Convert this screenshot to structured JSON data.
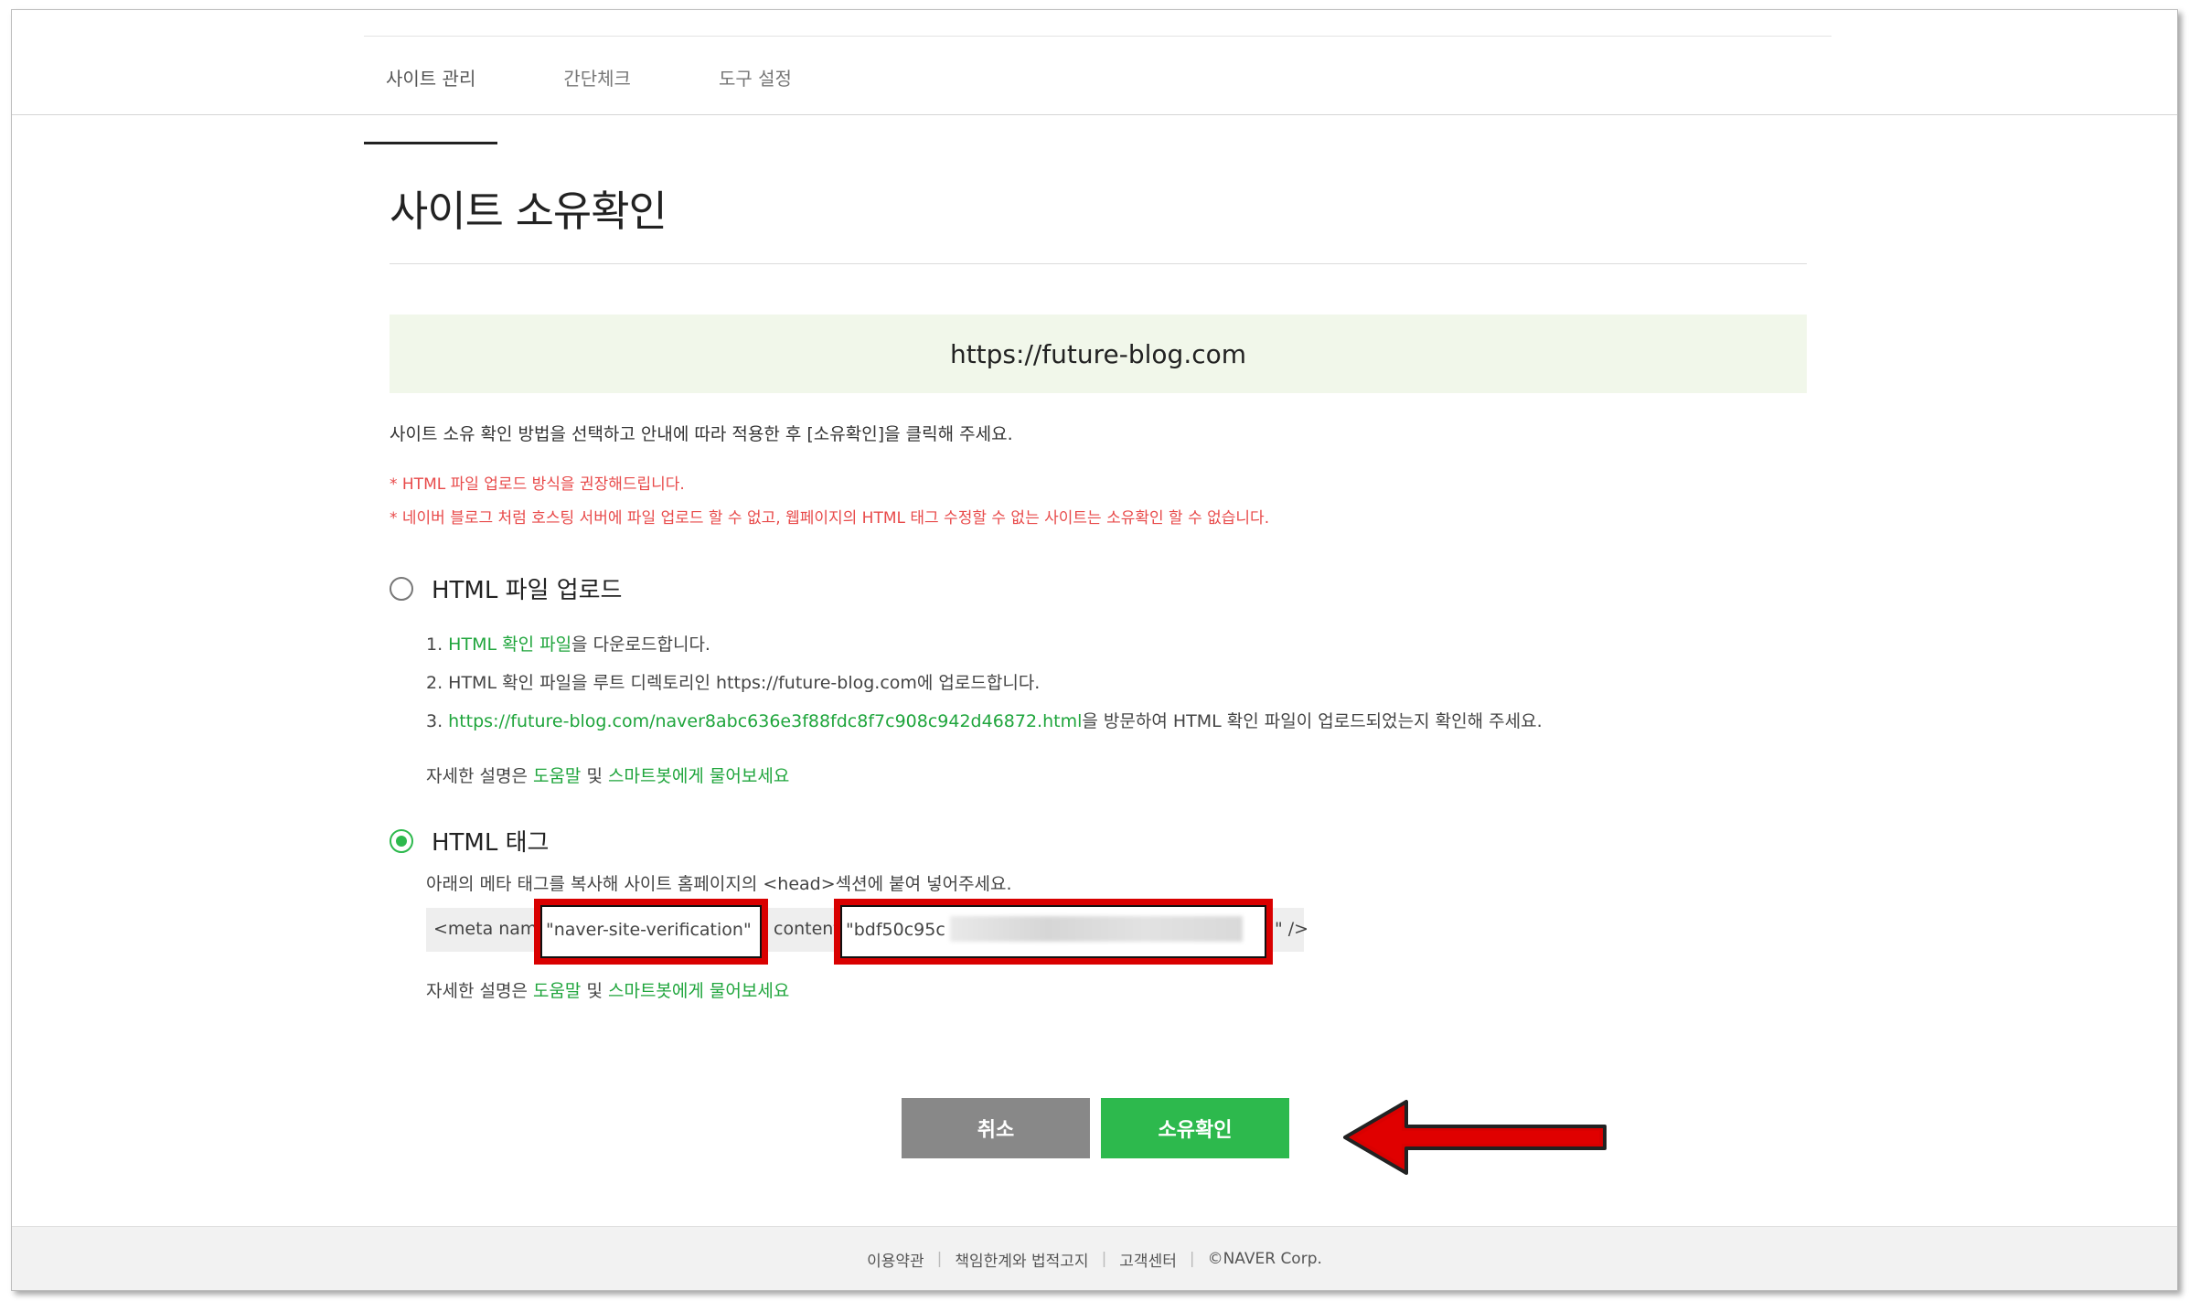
{
  "nav": {
    "tabs": [
      {
        "label": "사이트 관리",
        "active": true
      },
      {
        "label": "간단체크",
        "active": false
      },
      {
        "label": "도구 설정",
        "active": false
      }
    ]
  },
  "page": {
    "title": "사이트 소유확인",
    "site_url": "https://future-blog.com",
    "intro": "사이트 소유 확인 방법을 선택하고 안내에 따라 적용한 후 [소유확인]을 클릭해 주세요.",
    "warnings": [
      "* HTML 파일 업로드 방식을 권장해드립니다.",
      "* 네이버 블로그 처럼 호스팅 서버에 파일 업로드 할 수 없고, 웹페이지의 HTML 태그 수정할 수 없는 사이트는 소유확인 할 수 없습니다."
    ]
  },
  "option_file": {
    "label": "HTML 파일 업로드",
    "selected": false,
    "step1_prefix": "1. ",
    "step1_link": "HTML 확인 파일",
    "step1_suffix": "을 다운로드합니다.",
    "step2": "2. HTML 확인 파일을 루트 디렉토리인 https://future-blog.com에 업로드합니다.",
    "step3_prefix": "3. ",
    "step3_link": "https://future-blog.com/naver8abc636e3f88fdc8f7c908c942d46872.html",
    "step3_suffix": "을 방문하여 HTML 확인 파일이 업로드되었는지 확인해 주세요."
  },
  "help": {
    "prefix": "자세한 설명은 ",
    "link1": "도움말",
    "mid": " 및 ",
    "link2": "스마트봇에게 물어보세요"
  },
  "option_tag": {
    "label": "HTML 태그",
    "selected": true,
    "desc": "아래의 메타 태그를 복사해 사이트 홈페이지의 <head>섹션에 붙여 넣어주세요.",
    "meta_start": "<meta name",
    "meta_name_value": "\"naver-site-verification\"",
    "meta_content_label": "content",
    "meta_content_value": "\"bdf50c95c",
    "meta_end": "\" />"
  },
  "buttons": {
    "cancel": "취소",
    "confirm": "소유확인"
  },
  "footer": {
    "links": [
      "이용약관",
      "책임한계와 법적고지",
      "고객센터"
    ],
    "copyright": "©NAVER Corp."
  },
  "colors": {
    "accent_green": "#2db94d",
    "warning_red": "#e84a4a",
    "annotation_red": "#d90000"
  }
}
